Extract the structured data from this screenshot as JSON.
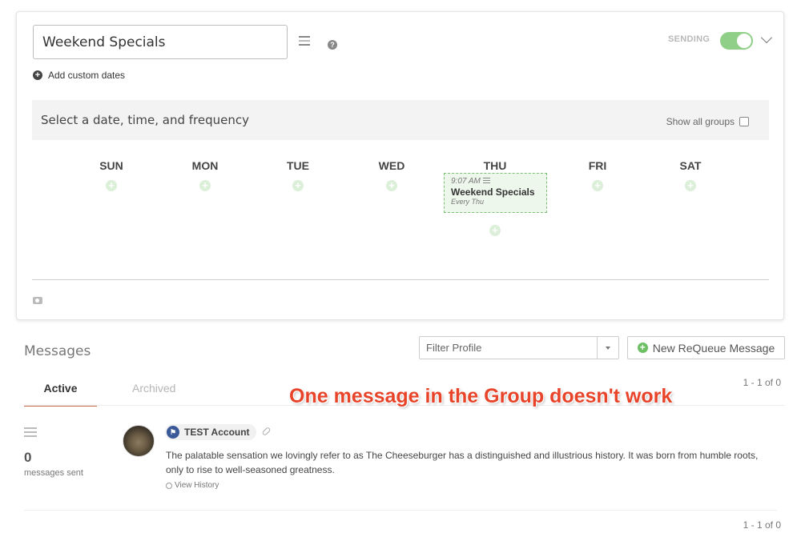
{
  "group": {
    "name": "Weekend Specials",
    "add_custom_dates": "Add custom dates",
    "status_label": "SENDING",
    "sending_enabled": true
  },
  "schedule": {
    "title": "Select a date, time, and frequency",
    "show_all_groups": "Show all groups",
    "days": [
      "SUN",
      "MON",
      "TUE",
      "WED",
      "THU",
      "FRI",
      "SAT"
    ],
    "event": {
      "day": "THU",
      "time": "9:07 AM",
      "name": "Weekend Specials",
      "frequency": "Every Thu"
    }
  },
  "messages": {
    "title": "Messages",
    "filter_placeholder": "Filter Profile",
    "new_button": "New ReQueue Message",
    "tabs": [
      "Active",
      "Archived"
    ],
    "active_tab": "Active",
    "pagination": "1 - 1 of 0",
    "stats": {
      "count": "0",
      "label": "messages sent"
    },
    "items": [
      {
        "account": "TEST Account",
        "text": "The palatable sensation we lovingly refer to as The Cheeseburger has a distinguished and illustrious history. It was born from humble roots, only to rise to well-seasoned greatness.",
        "history_link": "View History"
      }
    ]
  },
  "annotation": "One message in the Group doesn't work",
  "colors": {
    "toggle_on": "#8fcf88",
    "accent_tab": "#c96a4b",
    "annotation": "#e8442a",
    "event_border": "#7dbf75"
  },
  "icons": [
    "list-icon",
    "help-icon",
    "plus-circle-icon",
    "chevron-down-icon",
    "camera-icon",
    "link-icon",
    "facebook-flag-icon",
    "history-icon"
  ]
}
